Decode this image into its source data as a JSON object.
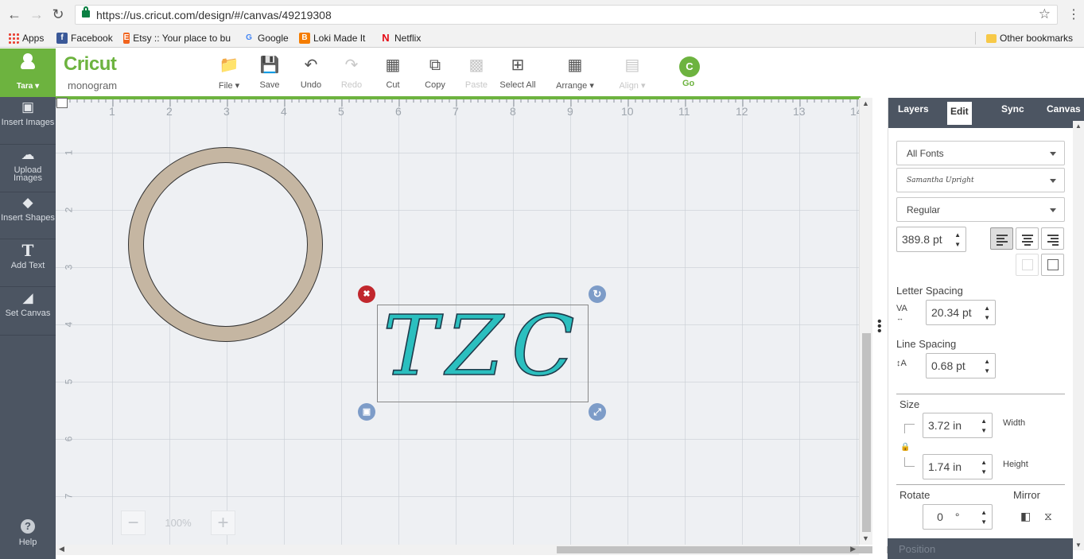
{
  "browser": {
    "url": "https://us.cricut.com/design/#/canvas/49219308",
    "bookmarks": [
      {
        "label": "Apps",
        "icon": "apps-grid-icon"
      },
      {
        "label": "Facebook",
        "icon": "facebook-icon"
      },
      {
        "label": "Etsy :: Your place to bu",
        "icon": "etsy-icon"
      },
      {
        "label": "Google",
        "icon": "google-icon"
      },
      {
        "label": "Loki Made It",
        "icon": "blogger-icon"
      },
      {
        "label": "Netflix",
        "icon": "netflix-icon"
      }
    ],
    "other_bookmarks": "Other bookmarks"
  },
  "sidebar": {
    "user": "Tara ▾",
    "items": [
      {
        "label": "Insert Images",
        "icon": "image-icon"
      },
      {
        "label": "Upload Images",
        "icon": "cloud-upload-icon"
      },
      {
        "label": "Insert Shapes",
        "icon": "shapes-icon"
      },
      {
        "label": "Add Text",
        "icon": "text-icon"
      },
      {
        "label": "Set Canvas",
        "icon": "shirt-icon"
      }
    ],
    "help": "Help"
  },
  "header": {
    "logo": "Cricut",
    "project_name": "monogram",
    "toolbar": {
      "file": "File ▾",
      "save": "Save",
      "undo": "Undo",
      "redo": "Redo",
      "cut": "Cut",
      "copy": "Copy",
      "paste": "Paste",
      "select_all": "Select All",
      "arrange": "Arrange ▾",
      "align": "Align ▾",
      "go": "Go",
      "go_icon_letter": "C"
    }
  },
  "canvas": {
    "ruler_top": [
      "1",
      "2",
      "3",
      "4",
      "5",
      "6",
      "7",
      "8",
      "9",
      "10",
      "11",
      "12",
      "13",
      "14"
    ],
    "ruler_left": [
      "1",
      "2",
      "3",
      "4",
      "5",
      "6",
      "7"
    ],
    "monogram_text": "TZC",
    "zoom": "100%",
    "zoom_minus": "−",
    "zoom_plus": "+",
    "ring_color": "#c5b6a2",
    "text_color": "#2bbfbf"
  },
  "panel": {
    "tabs": [
      "Layers",
      "Edit",
      "Sync",
      "Canvas"
    ],
    "active_tab": "Edit",
    "font_filter": "All Fonts",
    "font_name": "Samantha Upright",
    "font_style": "Regular",
    "font_size": "389.8",
    "font_size_unit": "pt",
    "letter_spacing_label": "Letter Spacing",
    "letter_spacing": "20.34",
    "letter_spacing_unit": "pt",
    "line_spacing_label": "Line Spacing",
    "line_spacing": "0.68",
    "line_spacing_unit": "pt",
    "size_label": "Size",
    "width": "3.72",
    "width_unit": "in",
    "width_label": "Width",
    "height": "1.74",
    "height_unit": "in",
    "height_label": "Height",
    "rotate_label": "Rotate",
    "rotate": "0",
    "rotate_unit": "°",
    "mirror_label": "Mirror",
    "position_label": "Position"
  }
}
